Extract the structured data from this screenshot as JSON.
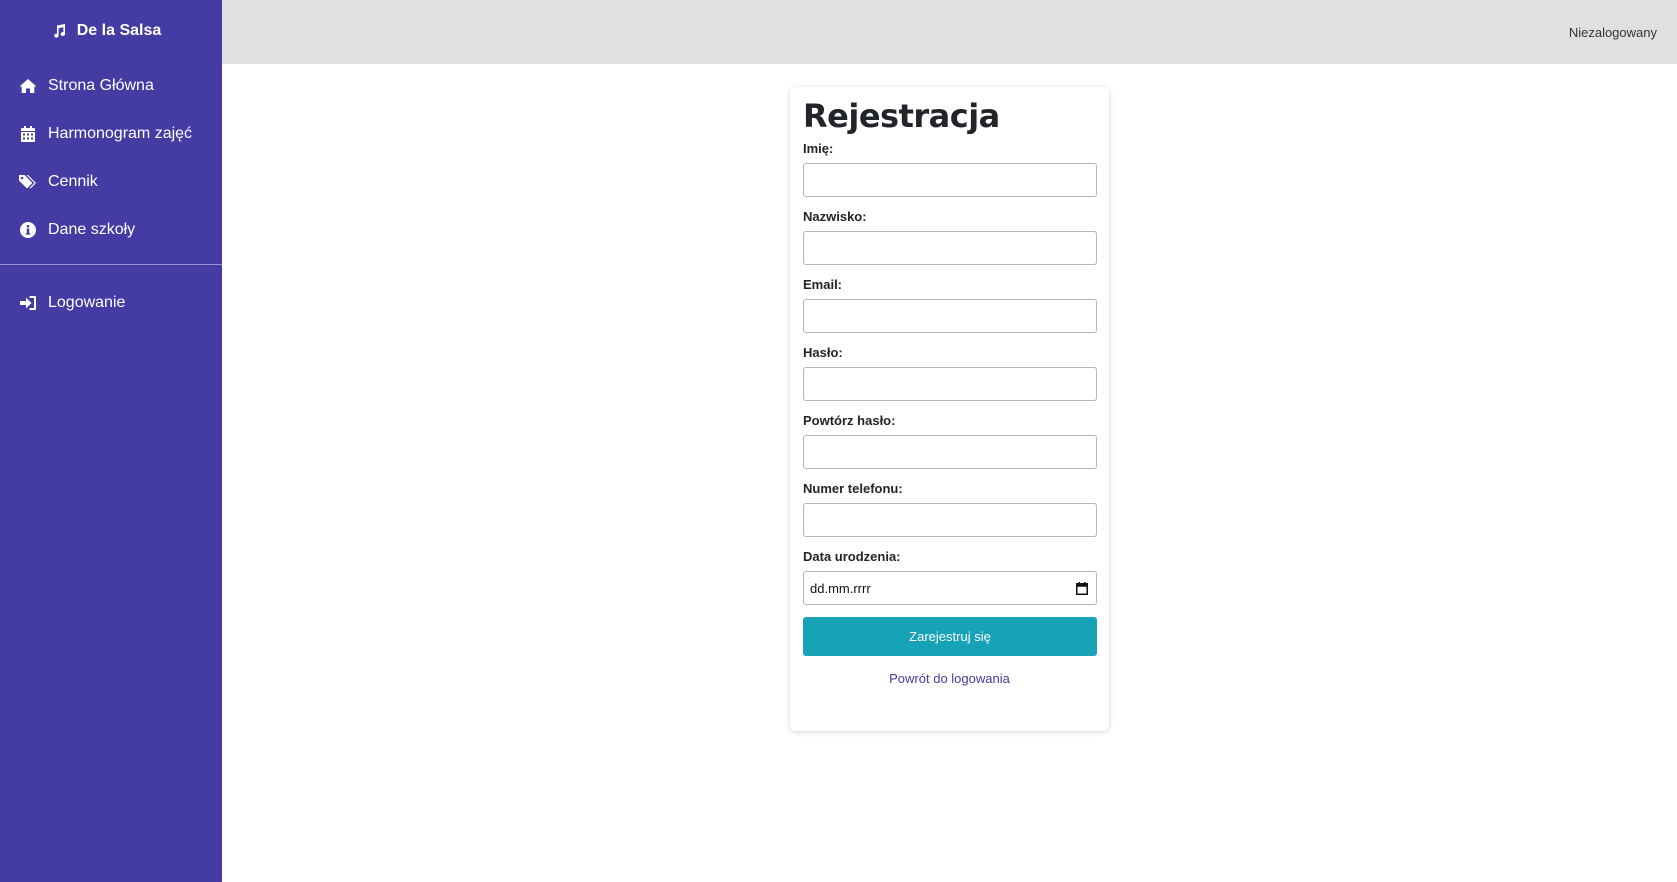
{
  "sidebar": {
    "brand": {
      "name": "De la Salsa",
      "icon": "music-note-icon"
    },
    "items": [
      {
        "label": "Strona Główna",
        "icon": "home-icon"
      },
      {
        "label": "Harmonogram zajęć",
        "icon": "calendar-icon"
      },
      {
        "label": "Cennik",
        "icon": "tags-icon"
      },
      {
        "label": "Dane szkoły",
        "icon": "info-circle-icon"
      }
    ],
    "login_item": {
      "label": "Logowanie",
      "icon": "sign-in-icon"
    }
  },
  "topbar": {
    "user_status": "Niezalogowany"
  },
  "form": {
    "title": "Rejestracja",
    "fields": [
      {
        "label": "Imię:",
        "value": ""
      },
      {
        "label": "Nazwisko:",
        "value": ""
      },
      {
        "label": "Email:",
        "value": ""
      },
      {
        "label": "Hasło:",
        "value": ""
      },
      {
        "label": "Powtórz hasło:",
        "value": ""
      },
      {
        "label": "Numer telefonu:",
        "value": ""
      },
      {
        "label": "Data urodzenia:",
        "value": "dd.mm.rrrr"
      }
    ],
    "submit_label": "Zarejestruj się",
    "back_link": "Powrót do logowania"
  },
  "colors": {
    "sidebar_bg": "#443ba3",
    "topbar_bg": "#e0e0e0",
    "submit_bg": "#17a2b8",
    "link": "#443ba3"
  }
}
